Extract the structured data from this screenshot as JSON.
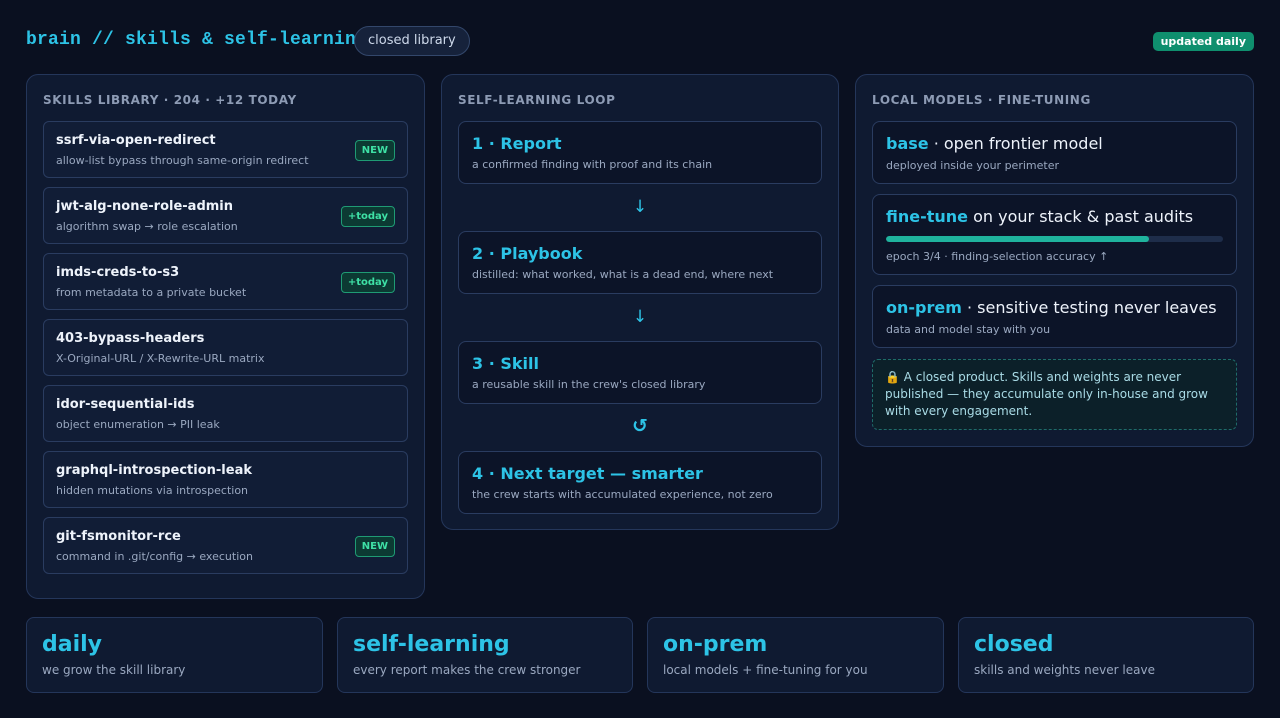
{
  "header": {
    "title": "brain // skills & self-learning",
    "pill": "closed library",
    "updated_badge": "updated daily"
  },
  "skills": {
    "heading": "SKILLS LIBRARY · 204 · +12 TODAY",
    "items": [
      {
        "name": "ssrf-via-open-redirect",
        "desc": "allow-list bypass through same-origin redirect",
        "badge": "NEW"
      },
      {
        "name": "jwt-alg-none-role-admin",
        "desc": "algorithm swap → role escalation",
        "badge": "+today"
      },
      {
        "name": "imds-creds-to-s3",
        "desc": "from metadata to a private bucket",
        "badge": "+today"
      },
      {
        "name": "403-bypass-headers",
        "desc": "X-Original-URL / X-Rewrite-URL matrix",
        "badge": ""
      },
      {
        "name": "idor-sequential-ids",
        "desc": "object enumeration → PII leak",
        "badge": ""
      },
      {
        "name": "graphql-introspection-leak",
        "desc": "hidden mutations via introspection",
        "badge": ""
      },
      {
        "name": "git-fsmonitor-rce",
        "desc": "command in .git/config → execution",
        "badge": "NEW"
      }
    ]
  },
  "loop": {
    "heading": "SELF-LEARNING LOOP",
    "steps": [
      {
        "title": "1 · Report",
        "desc": "a confirmed finding with proof and its chain"
      },
      {
        "title": "2 · Playbook",
        "desc": "distilled: what worked, what is a dead end, where next"
      },
      {
        "title": "3 · Skill",
        "desc": "a reusable skill in the crew's closed library"
      },
      {
        "title": "4 · Next target — smarter",
        "desc": "the crew starts with accumulated experience, not zero"
      }
    ],
    "arrows": [
      "↓",
      "↓",
      "↺"
    ]
  },
  "models": {
    "heading": "LOCAL MODELS · FINE-TUNING",
    "base": {
      "key": "base",
      "rest": " · open frontier model",
      "desc": "deployed inside your perimeter"
    },
    "finetune": {
      "key": "fine-tune",
      "rest": " on your stack & past audits",
      "desc": "epoch 3/4 · finding-selection accuracy ↑",
      "progress": 0.78
    },
    "onprem": {
      "key": "on-prem",
      "rest": " · sensitive testing never leaves",
      "desc": "data and model stay with you"
    },
    "note": "🔒 A closed product. Skills and weights are never published — they accumulate only in-house and grow with every engagement."
  },
  "stats": [
    {
      "big": "daily",
      "small": "we grow the skill library"
    },
    {
      "big": "self-learning",
      "small": "every report makes the crew stronger"
    },
    {
      "big": "on-prem",
      "small": "local models + fine-tuning for you"
    },
    {
      "big": "closed",
      "small": "skills and weights never leave"
    }
  ],
  "colors": {
    "accent": "#2dc3e6",
    "badge_green": "#3ee0a5",
    "background": "#0a1020"
  }
}
